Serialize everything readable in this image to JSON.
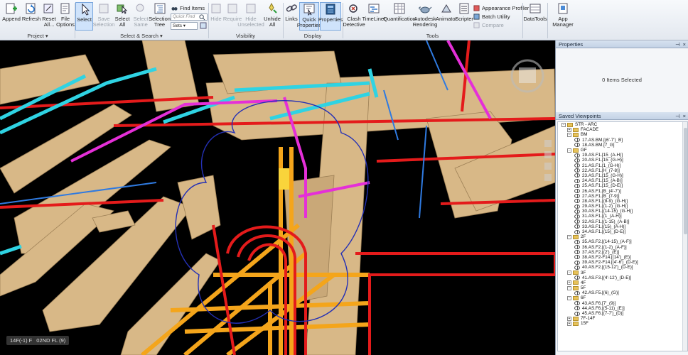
{
  "ribbon": {
    "project": {
      "group_label": "Project ▾",
      "append": "Append",
      "refresh": "Refresh",
      "reset_all": "Reset All...",
      "file_options": "File Options"
    },
    "select_search": {
      "group_label": "Select & Search ▾",
      "select": "Select",
      "save_selection": "Save Selection",
      "select_all": "Select All",
      "select_same": "Select Same",
      "selection_tree": "Selection Tree",
      "find_items": "Find Items",
      "quick_find_placeholder": "Quick Find",
      "sets": "Sets ▾"
    },
    "visibility": {
      "group_label": "Visibility",
      "hide": "Hide",
      "require": "Require",
      "hide_unselected": "Hide Unselected",
      "unhide_all": "Unhide All"
    },
    "display": {
      "group_label": "Display",
      "links": "Links",
      "quick_properties": "Quick Properties",
      "properties": "Properties"
    },
    "tools": {
      "group_label": "Tools",
      "clash_detective": "Clash Detective",
      "timeliner": "TimeLiner",
      "quantification": "Quantification",
      "autodesk_rendering": "Autodesk Rendering",
      "animator": "Animator",
      "scripter": "Scripter",
      "appearance_profiler": "Appearance Profiler",
      "batch_utility": "Batch Utility",
      "compare": "Compare"
    },
    "datatools": "DataTools",
    "app_manager": "App Manager"
  },
  "viewport": {
    "status_left": "14F(-1) F",
    "status_right": "02ND FL (9)"
  },
  "properties_panel": {
    "title": "Properties",
    "empty_text": "0 Items Selected"
  },
  "saved_viewpoints": {
    "title": "Saved Viewpoints",
    "rows": [
      {
        "label": "STR - ARC",
        "kind": "folder",
        "depth": 0,
        "exp": "-"
      },
      {
        "label": "FACADE",
        "kind": "folder",
        "depth": 1,
        "exp": "+"
      },
      {
        "label": "BM",
        "kind": "folder",
        "depth": 1,
        "exp": "-"
      },
      {
        "label": "17.AS.BM.[(6'-7')_B]",
        "kind": "vp",
        "depth": 2
      },
      {
        "label": "18.AS.BM.[7_G]",
        "kind": "vp",
        "depth": 2
      },
      {
        "label": "GF",
        "kind": "folder",
        "depth": 1,
        "exp": "-"
      },
      {
        "label": "19.AS.F1.[15_(A-H)]",
        "kind": "vp",
        "depth": 2
      },
      {
        "label": "20.AS.F1.[15_(G-H)]",
        "kind": "vp",
        "depth": 2
      },
      {
        "label": "21.AS.F1.[1_(G-H)]",
        "kind": "vp",
        "depth": 2
      },
      {
        "label": "22.AS.F1.[H_(7-8)]",
        "kind": "vp",
        "depth": 2
      },
      {
        "label": "23.AS.F1.[15_(G-H)]",
        "kind": "vp",
        "depth": 2
      },
      {
        "label": "24.AS.F1.[15_(A-B)]",
        "kind": "vp",
        "depth": 2
      },
      {
        "label": "25.AS.F1.[15_(D-E)]",
        "kind": "vp",
        "depth": 2
      },
      {
        "label": "26.AS.F1.[B_(4'-7')]",
        "kind": "vp",
        "depth": 2
      },
      {
        "label": "27.AS.F1.[B_(7-9)]",
        "kind": "vp",
        "depth": 2
      },
      {
        "label": "28.AS.F1.[(8-9)_(G-H)]",
        "kind": "vp",
        "depth": 2
      },
      {
        "label": "29.AS.F1.[(1-2)_(G-H)]",
        "kind": "vp",
        "depth": 2
      },
      {
        "label": "30.AS.F1.[(14-15)_(G-H)]",
        "kind": "vp",
        "depth": 2
      },
      {
        "label": "31.AS.F1.[(1_(A-H)]",
        "kind": "vp",
        "depth": 2
      },
      {
        "label": "32.AS.F1.[(1-15)_(A-B)]",
        "kind": "vp",
        "depth": 2
      },
      {
        "label": "33.AS.F1.[(15)_(A-H)]",
        "kind": "vp",
        "depth": 2
      },
      {
        "label": "34.AS.F1.[(15)_(D-E)]",
        "kind": "vp",
        "depth": 2
      },
      {
        "label": "2F",
        "kind": "folder",
        "depth": 1,
        "exp": "-"
      },
      {
        "label": "35.AS.F2.[(14-15)_(A-F)]",
        "kind": "vp",
        "depth": 2
      },
      {
        "label": "36.AS.F2.[(1-2)_(A-F)]",
        "kind": "vp",
        "depth": 2
      },
      {
        "label": "37.AS.F2.[(2')_(E)]",
        "kind": "vp",
        "depth": 2
      },
      {
        "label": "38.AS.F2-F14.[(14')_(E)]",
        "kind": "vp",
        "depth": 2
      },
      {
        "label": "39.AS.F2-F14.[(4'-6')_(D-E)]",
        "kind": "vp",
        "depth": 2
      },
      {
        "label": "40.AS.F2.[(15-12')_(D-E)]",
        "kind": "vp",
        "depth": 2
      },
      {
        "label": "3F",
        "kind": "folder",
        "depth": 1,
        "exp": "-"
      },
      {
        "label": "41.AS.F3.[(4'-12')_(D-E)]",
        "kind": "vp",
        "depth": 2
      },
      {
        "label": "4F",
        "kind": "folder",
        "depth": 1,
        "exp": "+"
      },
      {
        "label": "5F",
        "kind": "folder",
        "depth": 1,
        "exp": "-"
      },
      {
        "label": "42.AS.F5.[(6)_(G)]",
        "kind": "vp",
        "depth": 2
      },
      {
        "label": "6F",
        "kind": "folder",
        "depth": 1,
        "exp": "-"
      },
      {
        "label": "43.AS.F6.[7'_(9)]",
        "kind": "vp",
        "depth": 2
      },
      {
        "label": "44.AS.F6.[(5-11)_(E)]",
        "kind": "vp",
        "depth": 2
      },
      {
        "label": "45.AS.F6.[(7-7')_(D)]",
        "kind": "vp",
        "depth": 2
      },
      {
        "label": "7F-14F",
        "kind": "folder",
        "depth": 1,
        "exp": "+"
      },
      {
        "label": "15F",
        "kind": "folder",
        "depth": 1,
        "exp": "+"
      }
    ]
  },
  "colors": {
    "ribbon_active": "#cfe3fb",
    "viewport_bg": "#000000",
    "duct_tan": "#d8b887",
    "pipe_cyan": "#2fd3e3",
    "pipe_magenta": "#e52fd8",
    "pipe_red": "#e41b1b",
    "pipe_orange": "#f4a51b",
    "pipe_blue": "#2f7ae0",
    "clash_outline": "#2430b5"
  }
}
